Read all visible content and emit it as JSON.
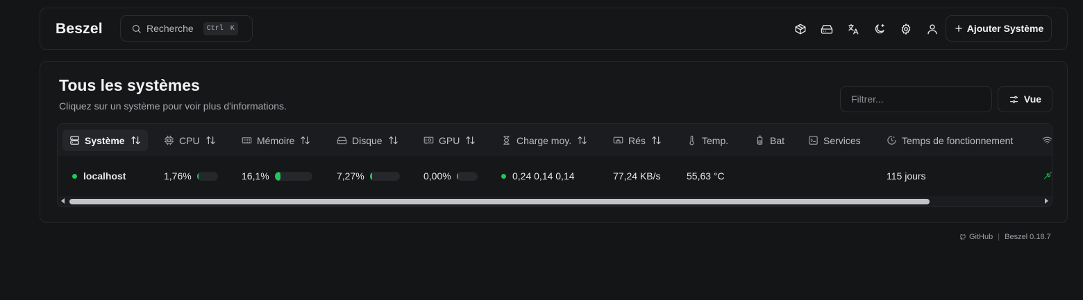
{
  "header": {
    "logo": "Beszel",
    "search": {
      "label": "Recherche",
      "kbd": [
        "Ctrl",
        "K"
      ]
    },
    "icons": [
      "containers-icon",
      "drive-icon",
      "translate-icon",
      "theme-icon",
      "settings-icon",
      "user-icon"
    ],
    "add_button": "Ajouter Système"
  },
  "main": {
    "title": "Tous les systèmes",
    "subtitle": "Cliquez sur un système pour voir plus d'informations.",
    "filter_placeholder": "Filtrer...",
    "view_button": "Vue"
  },
  "table": {
    "columns": [
      {
        "label": "Système",
        "icon": "server-icon",
        "sortable": true,
        "active": true
      },
      {
        "label": "CPU",
        "icon": "cpu-icon",
        "sortable": true
      },
      {
        "label": "Mémoire",
        "icon": "memory-icon",
        "sortable": true
      },
      {
        "label": "Disque",
        "icon": "drive-icon",
        "sortable": true
      },
      {
        "label": "GPU",
        "icon": "gpu-icon",
        "sortable": true
      },
      {
        "label": "Charge moy.",
        "icon": "hourglass-icon",
        "sortable": true
      },
      {
        "label": "Rés",
        "icon": "network-icon",
        "sortable": true
      },
      {
        "label": "Temp.",
        "icon": "thermometer-icon",
        "sortable": false
      },
      {
        "label": "Bat",
        "icon": "battery-icon",
        "sortable": false
      },
      {
        "label": "Services",
        "icon": "terminal-icon",
        "sortable": false
      },
      {
        "label": "Temps de fonctionnement",
        "icon": "clock-icon",
        "sortable": false
      }
    ],
    "rows": [
      {
        "name": "localhost",
        "status": "up",
        "cpu": "1,76%",
        "cpu_pct": 1.76,
        "memory": "16,1%",
        "memory_pct": 16.1,
        "disk": "7,27%",
        "disk_pct": 7.27,
        "gpu": "0,00%",
        "gpu_pct": 0,
        "load": "0,24 0,14 0,14",
        "net": "77,24 KB/s",
        "temp": "55,63 °C",
        "uptime": "115 jours"
      }
    ]
  },
  "footer": {
    "github": "GitHub",
    "version": "Beszel 0.18.7"
  },
  "colors": {
    "accent": "#22c55e",
    "background": "#141517"
  }
}
